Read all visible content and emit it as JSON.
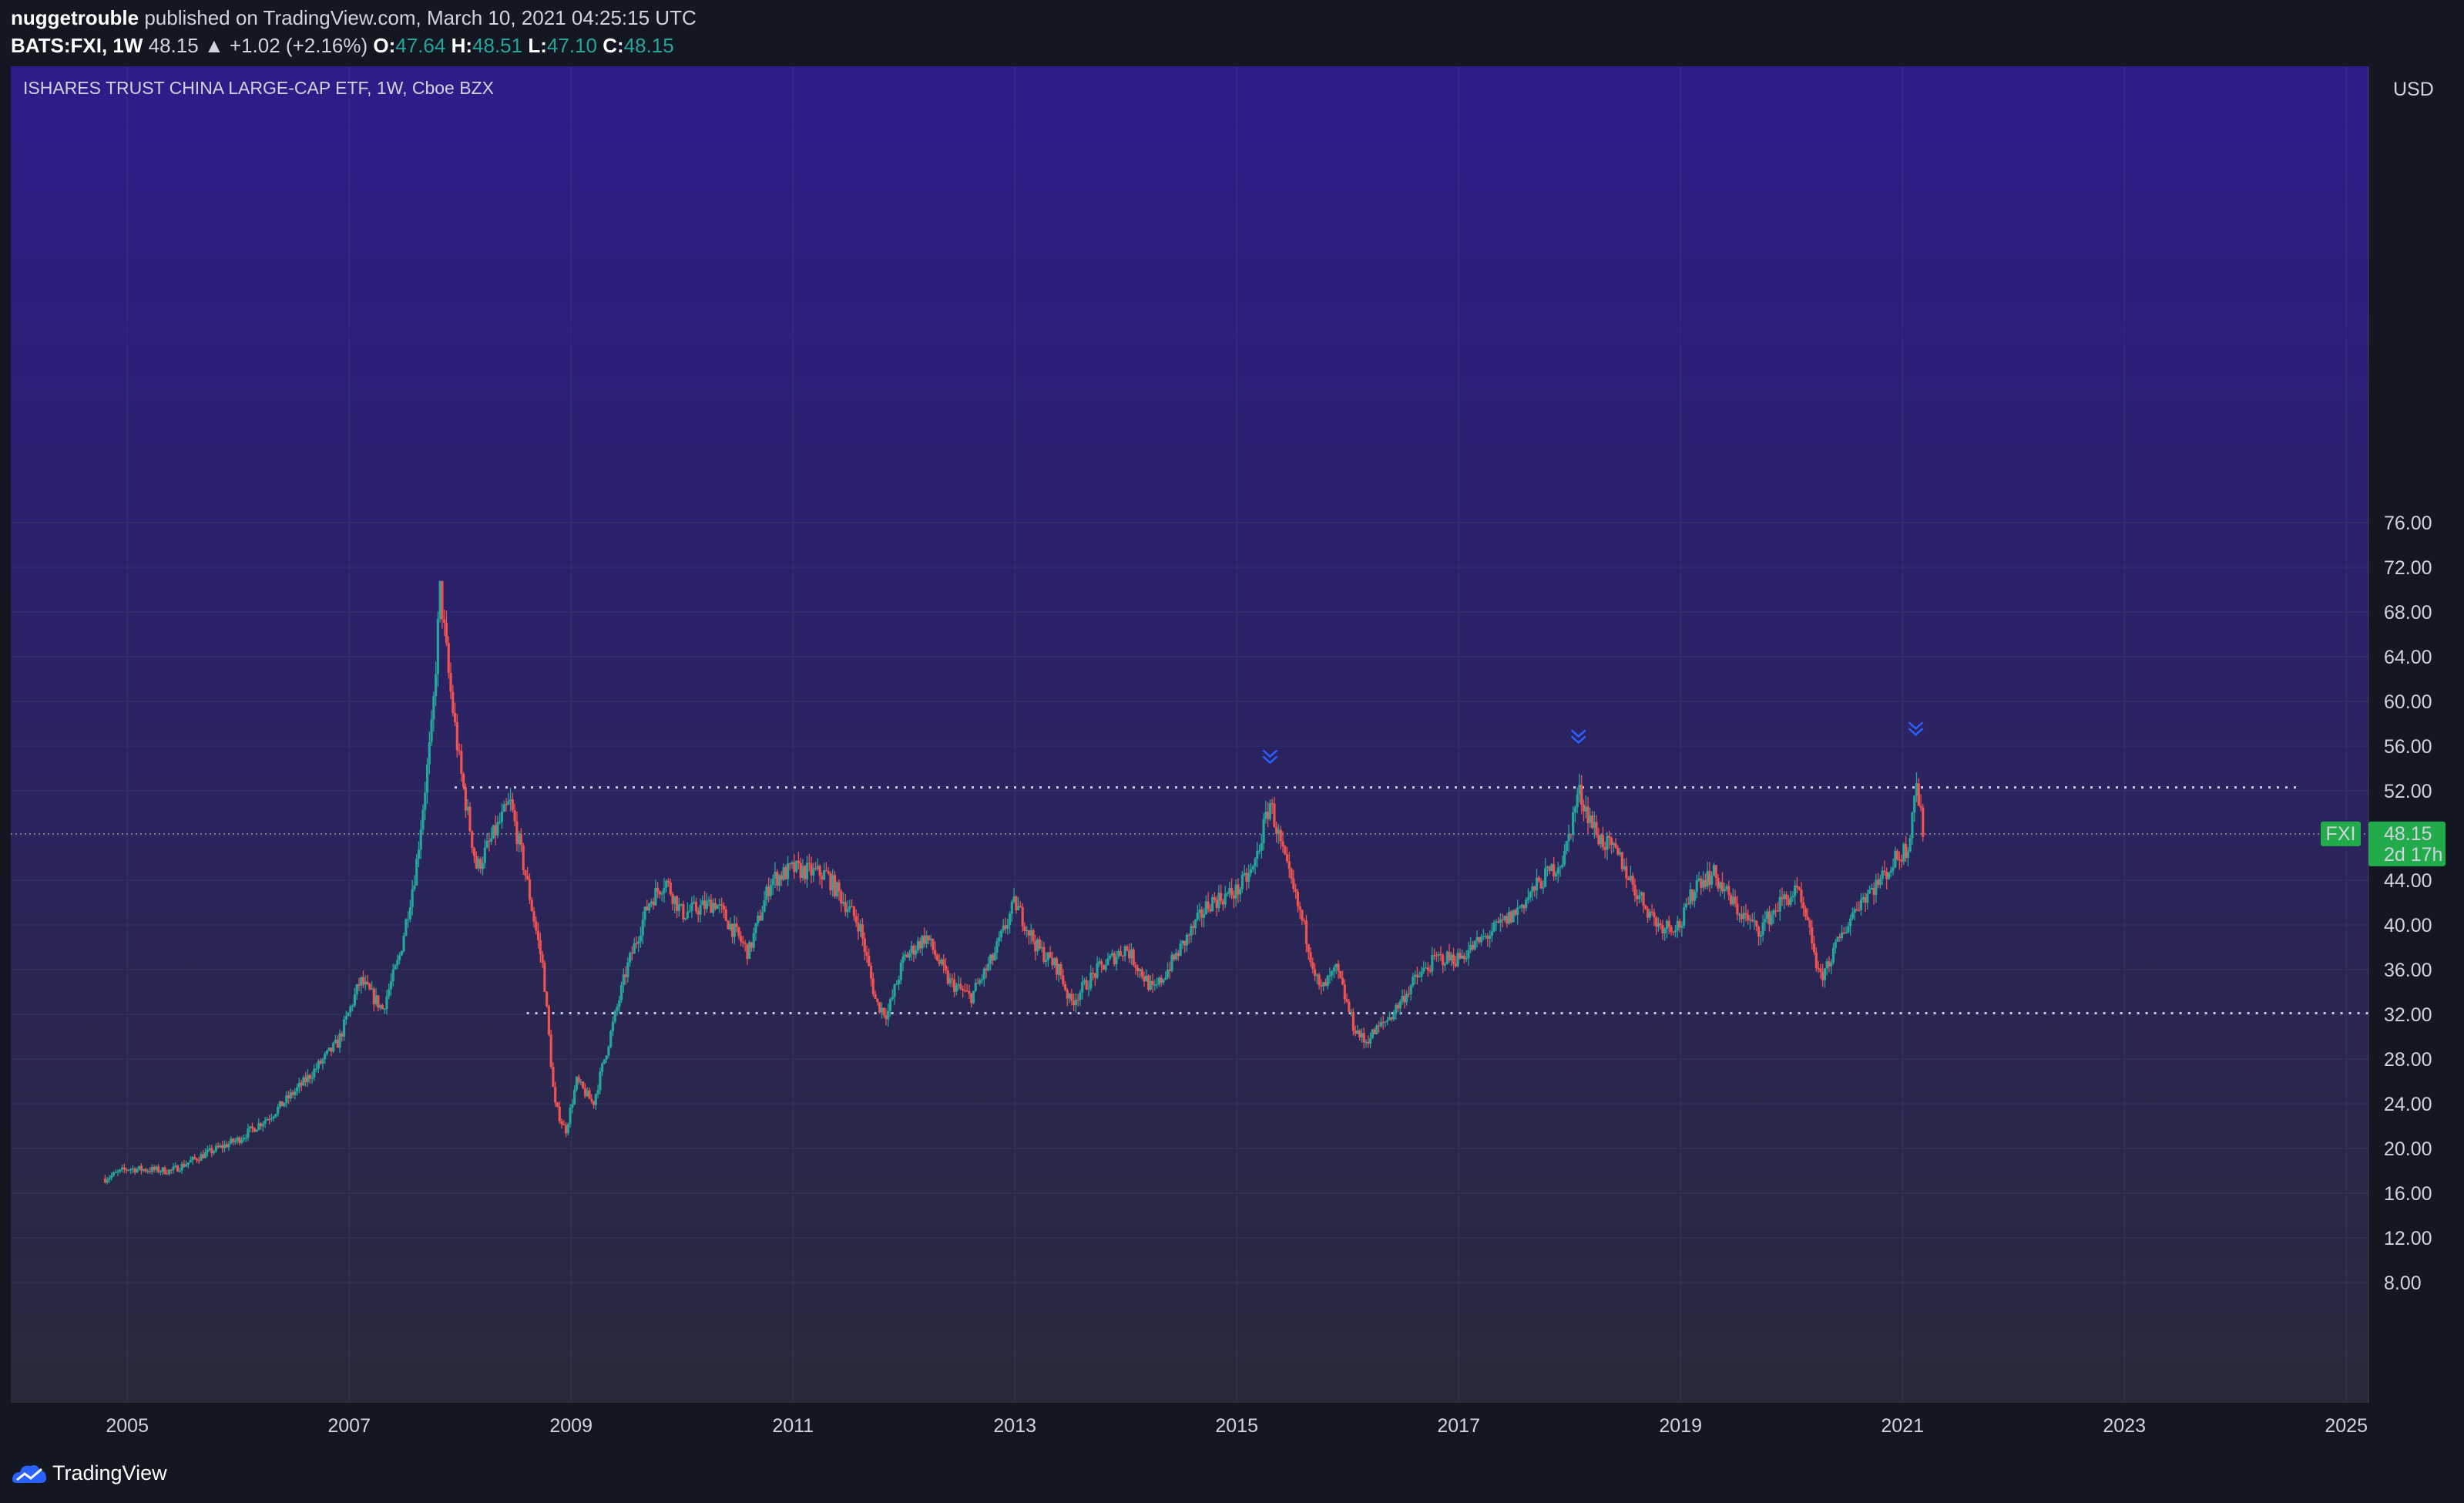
{
  "header": {
    "author": "nuggetrouble",
    "published": "published on TradingView.com, March 10, 2021 04:25:15 UTC",
    "symbol": "BATS:FXI, 1W",
    "last": "48.15",
    "change": "▲ +1.02 (+2.16%)",
    "o_label": "O:",
    "o_value": "47.64",
    "h_label": "H:",
    "h_value": "48.51",
    "l_label": "L:",
    "l_value": "47.10",
    "c_label": "C:",
    "c_value": "48.15"
  },
  "chart_data": {
    "type": "candlestick",
    "title": "ISHARES TRUST CHINA LARGE-CAP ETF, 1W, Cboe BZX",
    "currency": "USD",
    "x_range": [
      2003.95,
      2025.2
    ],
    "ylim": [
      8,
      80
    ],
    "y_ticks": [
      8,
      12,
      16,
      20,
      24,
      28,
      32,
      36,
      40,
      44,
      48,
      52,
      56,
      60,
      64,
      68,
      72,
      76
    ],
    "y_tick_labels": [
      "8.00",
      "12.00",
      "16.00",
      "20.00",
      "24.00",
      "28.00",
      "32.00",
      "36.00",
      "40.00",
      "44.00",
      "48.00",
      "52.00",
      "56.00",
      "60.00",
      "64.00",
      "68.00",
      "72.00",
      "76.00"
    ],
    "x_ticks": [
      2005,
      2007,
      2009,
      2011,
      2013,
      2015,
      2017,
      2019,
      2021,
      2023,
      2025
    ],
    "x_tick_labels": [
      "2005",
      "2007",
      "2009",
      "2011",
      "2013",
      "2015",
      "2017",
      "2019",
      "2021",
      "2023",
      "2025"
    ],
    "grid": true,
    "up_color": "#26a69a",
    "down_color": "#ef5350",
    "price_path": [
      [
        2004.8,
        17.3
      ],
      [
        2005.0,
        18.2
      ],
      [
        2005.4,
        18.0
      ],
      [
        2005.7,
        19.5
      ],
      [
        2006.0,
        20.8
      ],
      [
        2006.3,
        23.0
      ],
      [
        2006.6,
        26.0
      ],
      [
        2006.9,
        29.5
      ],
      [
        2007.1,
        35.0
      ],
      [
        2007.3,
        32.5
      ],
      [
        2007.45,
        37.0
      ],
      [
        2007.6,
        45.0
      ],
      [
        2007.75,
        58.0
      ],
      [
        2007.82,
        70.0
      ],
      [
        2007.9,
        62.0
      ],
      [
        2008.0,
        54.0
      ],
      [
        2008.15,
        45.0
      ],
      [
        2008.3,
        48.0
      ],
      [
        2008.45,
        51.0
      ],
      [
        2008.6,
        44.0
      ],
      [
        2008.75,
        36.0
      ],
      [
        2008.85,
        24.0
      ],
      [
        2008.95,
        21.5
      ],
      [
        2009.05,
        26.0
      ],
      [
        2009.2,
        24.0
      ],
      [
        2009.35,
        30.0
      ],
      [
        2009.5,
        36.0
      ],
      [
        2009.7,
        42.0
      ],
      [
        2009.85,
        44.0
      ],
      [
        2010.0,
        41.0
      ],
      [
        2010.3,
        42.0
      ],
      [
        2010.6,
        37.5
      ],
      [
        2010.8,
        44.0
      ],
      [
        2011.0,
        45.0
      ],
      [
        2011.3,
        44.5
      ],
      [
        2011.6,
        40.0
      ],
      [
        2011.75,
        33.0
      ],
      [
        2011.85,
        32.0
      ],
      [
        2012.0,
        37.0
      ],
      [
        2012.2,
        39.0
      ],
      [
        2012.4,
        35.0
      ],
      [
        2012.6,
        33.5
      ],
      [
        2012.8,
        37.0
      ],
      [
        2013.0,
        42.0
      ],
      [
        2013.2,
        38.0
      ],
      [
        2013.4,
        36.0
      ],
      [
        2013.5,
        33.0
      ],
      [
        2013.75,
        36.0
      ],
      [
        2014.0,
        38.0
      ],
      [
        2014.25,
        34.0
      ],
      [
        2014.5,
        38.0
      ],
      [
        2014.75,
        42.0
      ],
      [
        2015.0,
        43.0
      ],
      [
        2015.15,
        45.0
      ],
      [
        2015.3,
        51.0
      ],
      [
        2015.45,
        45.0
      ],
      [
        2015.6,
        40.0
      ],
      [
        2015.75,
        34.0
      ],
      [
        2015.9,
        36.0
      ],
      [
        2016.05,
        31.0
      ],
      [
        2016.15,
        29.5
      ],
      [
        2016.4,
        32.0
      ],
      [
        2016.6,
        35.0
      ],
      [
        2016.8,
        37.0
      ],
      [
        2017.0,
        37.0
      ],
      [
        2017.25,
        39.0
      ],
      [
        2017.5,
        41.0
      ],
      [
        2017.75,
        44.0
      ],
      [
        2017.95,
        46.0
      ],
      [
        2018.08,
        52.0
      ],
      [
        2018.25,
        48.0
      ],
      [
        2018.45,
        46.0
      ],
      [
        2018.6,
        43.0
      ],
      [
        2018.8,
        40.0
      ],
      [
        2019.0,
        40.0
      ],
      [
        2019.15,
        44.0
      ],
      [
        2019.3,
        44.5
      ],
      [
        2019.5,
        41.5
      ],
      [
        2019.7,
        39.5
      ],
      [
        2019.9,
        42.0
      ],
      [
        2020.05,
        43.0
      ],
      [
        2020.2,
        38.0
      ],
      [
        2020.25,
        35.0
      ],
      [
        2020.4,
        38.0
      ],
      [
        2020.6,
        42.0
      ],
      [
        2020.8,
        44.0
      ],
      [
        2020.95,
        46.0
      ],
      [
        2021.05,
        47.0
      ],
      [
        2021.12,
        53.0
      ],
      [
        2021.16,
        50.0
      ],
      [
        2021.19,
        48.15
      ]
    ],
    "last_price": 48.15,
    "last_price_label": "48.15",
    "countdown_label": "2d 17h",
    "symbol_tag": "FXI",
    "annotations": {
      "resistance_level": 52.3,
      "support_level": 32.1,
      "resistance_x_range": [
        2007.95,
        2024.6
      ],
      "support_x_range": [
        2008.6,
        2025.2
      ],
      "top_markers": [
        {
          "x": 2015.3,
          "y": 55.0
        },
        {
          "x": 2018.08,
          "y": 56.8
        },
        {
          "x": 2021.12,
          "y": 57.5
        }
      ]
    }
  },
  "footer": {
    "brand": "TradingView"
  },
  "colors": {
    "bg_top": "#2e1c8a",
    "bg_bottom": "#282a3a",
    "grid": "#3a3f66",
    "up": "#26a69a",
    "down": "#ef5350",
    "last_price_badge": "#22ab4a",
    "marker": "#2962ff",
    "level_line": "#c9cde6"
  }
}
